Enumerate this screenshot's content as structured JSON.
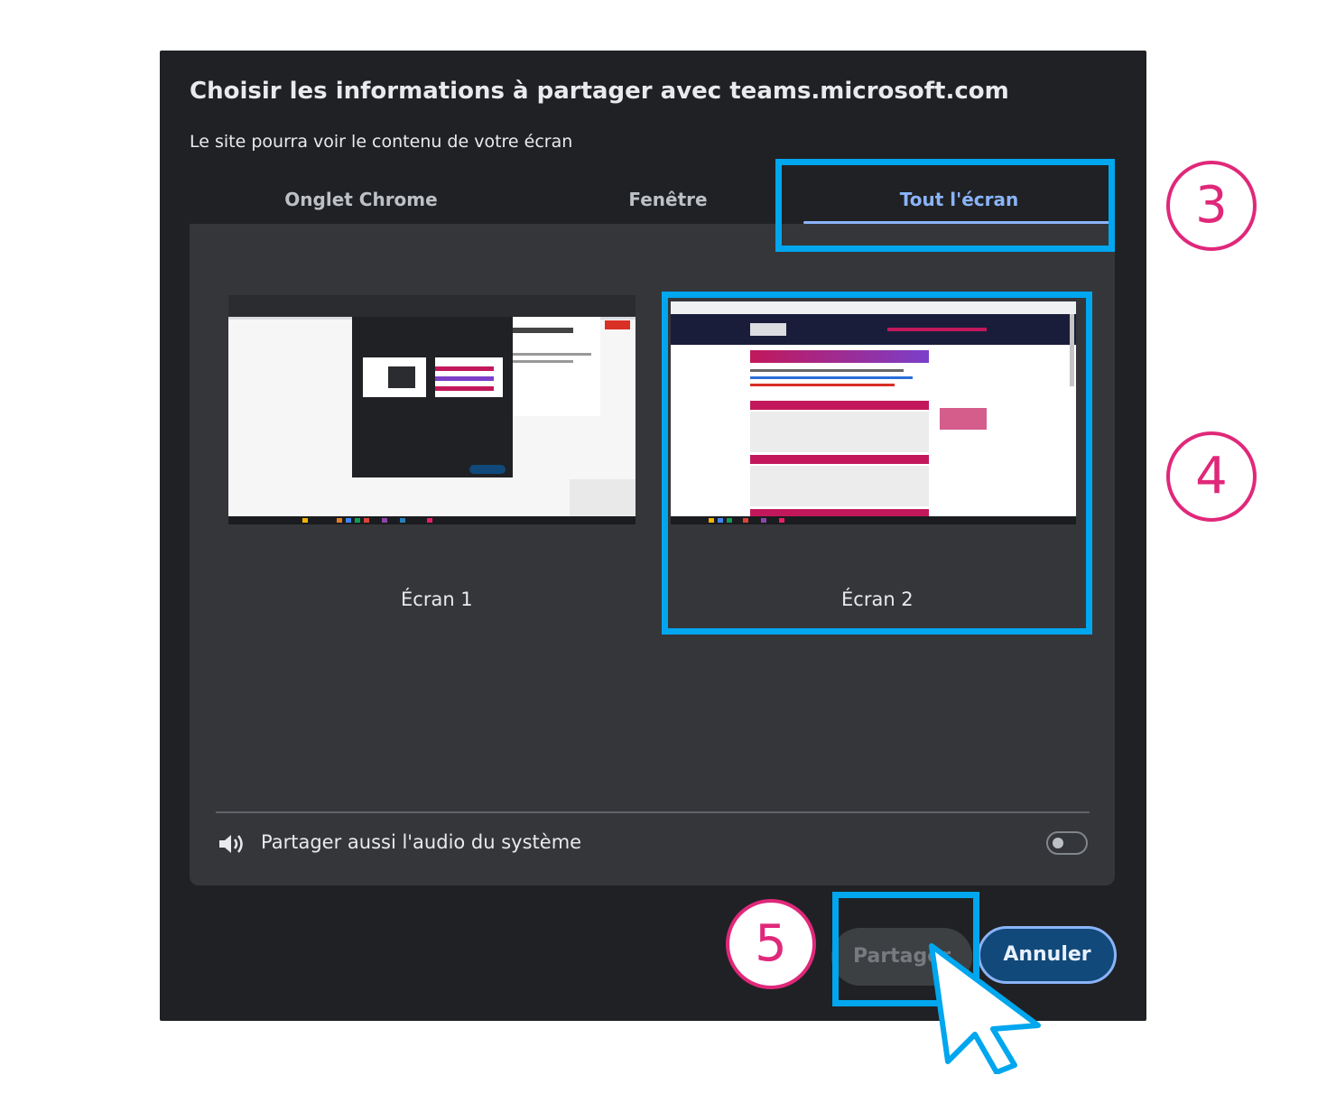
{
  "dialog": {
    "title": "Choisir les informations à partager avec teams.microsoft.com",
    "subtitle": "Le site pourra voir le contenu de votre écran"
  },
  "tabs": [
    {
      "label": "Onglet Chrome",
      "active": false
    },
    {
      "label": "Fenêtre",
      "active": false
    },
    {
      "label": "Tout l'écran",
      "active": true
    }
  ],
  "screens": [
    {
      "label": "Écran 1",
      "selected": false
    },
    {
      "label": "Écran 2",
      "selected": true
    }
  ],
  "audio": {
    "label": "Partager aussi l'audio du système",
    "enabled": false,
    "icon": "speaker-icon"
  },
  "buttons": {
    "share": "Partager",
    "cancel": "Annuler"
  },
  "annotations": {
    "step3": "3",
    "step4": "4",
    "step5": "5"
  },
  "colors": {
    "accent": "#8ab4f8",
    "highlight": "#00a6ee",
    "step_marker": "#e0287a",
    "dialog_bg": "#202124",
    "panel_bg": "#35363a"
  }
}
